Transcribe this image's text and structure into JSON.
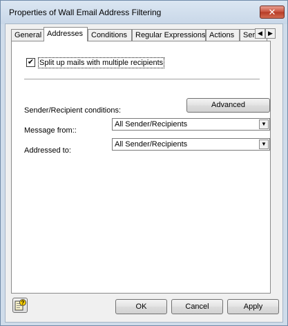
{
  "window": {
    "title": "Properties of Wall Email Address Filtering",
    "close_glyph": "✕"
  },
  "tabs": [
    {
      "label": "General"
    },
    {
      "label": "Addresses"
    },
    {
      "label": "Conditions"
    },
    {
      "label": "Regular Expressions"
    },
    {
      "label": "Actions"
    },
    {
      "label": "Ser"
    }
  ],
  "tab_scroll": {
    "left_glyph": "◀",
    "right_glyph": "▶"
  },
  "addresses": {
    "split_checkbox": {
      "checked": true,
      "glyph": "✔",
      "label": "Split up mails with multiple recipients"
    },
    "conditions_label": "Sender/Recipient conditions:",
    "advanced_button": "Advanced",
    "message_from": {
      "label": "Message from::",
      "value": "All Sender/Recipients"
    },
    "addressed_to": {
      "label": "Addressed to:",
      "value": "All Sender/Recipients"
    }
  },
  "footer": {
    "help_icon": "help-icon",
    "ok": "OK",
    "cancel": "Cancel",
    "apply": "Apply"
  },
  "colors": {
    "window_frame": "#cfdcea",
    "close_button": "#c7503c",
    "panel_bg": "#ffffff",
    "dialog_bg": "#f0f0f0"
  }
}
